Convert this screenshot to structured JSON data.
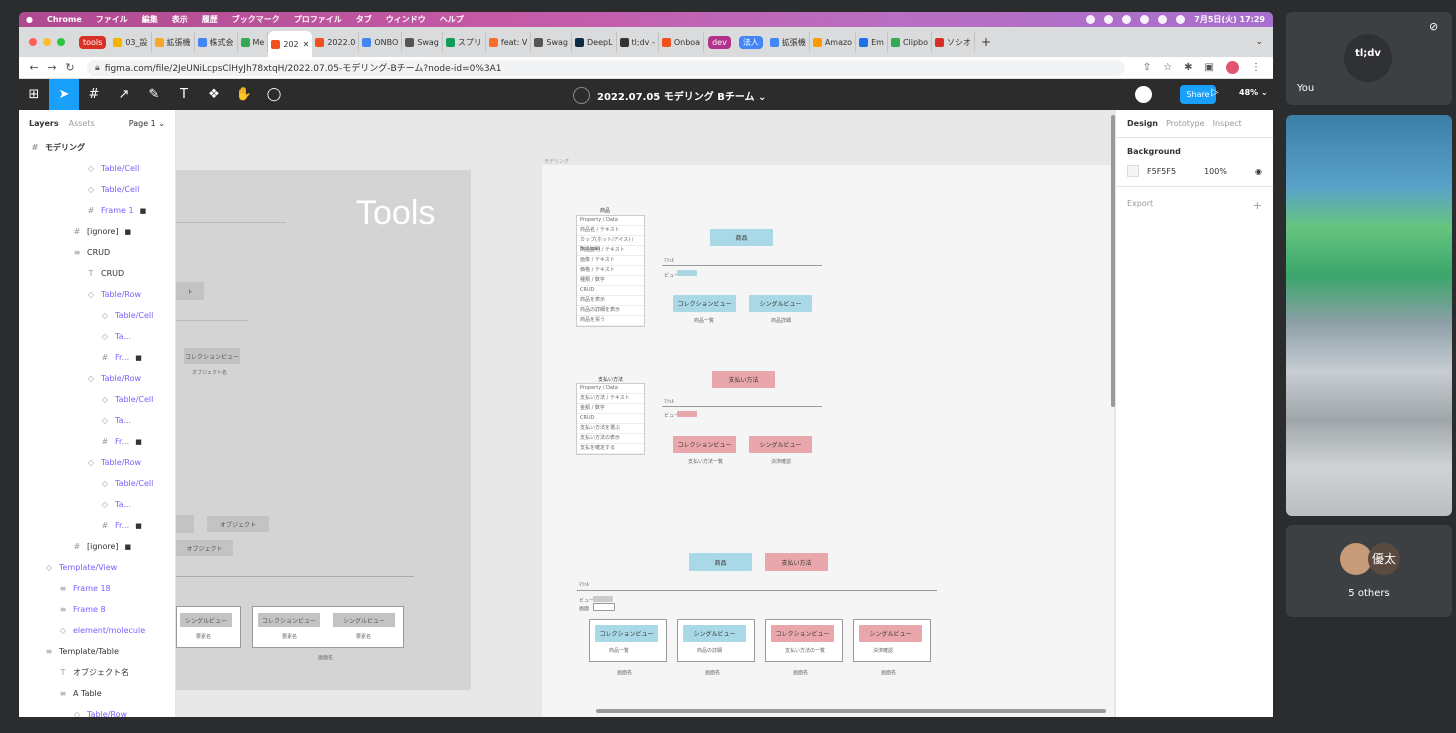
{
  "menubar": {
    "app": "Chrome",
    "items": [
      "ファイル",
      "編集",
      "表示",
      "履歴",
      "ブックマーク",
      "プロファイル",
      "タブ",
      "ウィンドウ",
      "ヘルプ"
    ],
    "datetime": "7月5日(火) 17:29"
  },
  "tabs": [
    {
      "label": "tools",
      "kind": "pill",
      "color": "#d93025"
    },
    {
      "label": "03_設",
      "color": "#f4b400"
    },
    {
      "label": "拡張機",
      "color": "#f9a825"
    },
    {
      "label": "株式会",
      "color": "#4285f4"
    },
    {
      "label": "Me",
      "color": "#34a853"
    },
    {
      "label": "202",
      "color": "#f24e1e",
      "active": true
    },
    {
      "label": "2022.0",
      "color": "#f24e1e"
    },
    {
      "label": "ONBO",
      "color": "#4285f4"
    },
    {
      "label": "Swag",
      "color": "#555555"
    },
    {
      "label": "スプリ",
      "color": "#0f9d58"
    },
    {
      "label": "feat: V",
      "color": "#fc6d26"
    },
    {
      "label": "Swag",
      "color": "#555555"
    },
    {
      "label": "DeepL",
      "color": "#0f2b46"
    },
    {
      "label": "tl;dv -",
      "color": "#333333"
    },
    {
      "label": "Onboa",
      "color": "#f24e1e"
    },
    {
      "label": "dev",
      "kind": "pill",
      "color": "#b0328a"
    },
    {
      "label": "法人",
      "kind": "pill",
      "color": "#4285f4"
    },
    {
      "label": "拡張機",
      "color": "#4285f4"
    },
    {
      "label": "Amazo",
      "color": "#ff9900"
    },
    {
      "label": "Em",
      "color": "#1a73e8"
    },
    {
      "label": "Clipbo",
      "color": "#34a853"
    },
    {
      "label": "ソシオ",
      "color": "#d93025"
    }
  ],
  "address": {
    "url": "figma.com/file/2JeUNiLcpsClHyJh78xtqH/2022.07.05-モデリング-Bチーム?node-id=0%3A1"
  },
  "figma": {
    "title": "2022.07.05 モデリング Bチーム",
    "share": "Share",
    "zoom": "48%"
  },
  "layers": {
    "tabs": [
      "Layers",
      "Assets"
    ],
    "page": "Page 1",
    "root": "モデリング",
    "rows": [
      {
        "label": "Table/Cell",
        "indent": 4,
        "icon": "◇",
        "purple": true
      },
      {
        "label": "Table/Cell",
        "indent": 4,
        "icon": "◇",
        "purple": true
      },
      {
        "label": "Frame 1",
        "indent": 4,
        "icon": "#",
        "purple": true,
        "lock": true
      },
      {
        "label": "[ignore]",
        "indent": 3,
        "icon": "#",
        "lock": true
      },
      {
        "label": "CRUD",
        "indent": 3,
        "icon": "≡"
      },
      {
        "label": "CRUD",
        "indent": 4,
        "icon": "T"
      },
      {
        "label": "Table/Row",
        "indent": 4,
        "icon": "◇",
        "purple": true
      },
      {
        "label": "Table/Cell",
        "indent": 5,
        "icon": "◇",
        "purple": true
      },
      {
        "label": "Ta...",
        "indent": 5,
        "icon": "◇",
        "purple": true
      },
      {
        "label": "Fr...",
        "indent": 5,
        "icon": "#",
        "purple": true,
        "lock": true
      },
      {
        "label": "Table/Row",
        "indent": 4,
        "icon": "◇",
        "purple": true
      },
      {
        "label": "Table/Cell",
        "indent": 5,
        "icon": "◇",
        "purple": true
      },
      {
        "label": "Ta...",
        "indent": 5,
        "icon": "◇",
        "purple": true
      },
      {
        "label": "Fr...",
        "indent": 5,
        "icon": "#",
        "purple": true,
        "lock": true
      },
      {
        "label": "Table/Row",
        "indent": 4,
        "icon": "◇",
        "purple": true
      },
      {
        "label": "Table/Cell",
        "indent": 5,
        "icon": "◇",
        "purple": true
      },
      {
        "label": "Ta...",
        "indent": 5,
        "icon": "◇",
        "purple": true
      },
      {
        "label": "Fr...",
        "indent": 5,
        "icon": "#",
        "purple": true,
        "lock": true
      },
      {
        "label": "[ignore]",
        "indent": 3,
        "icon": "#",
        "lock": true
      },
      {
        "label": "Template/View",
        "indent": 1,
        "icon": "◇",
        "purple": true
      },
      {
        "label": "Frame 18",
        "indent": 2,
        "icon": "≡",
        "purple": true
      },
      {
        "label": "Frame 8",
        "indent": 2,
        "icon": "≡",
        "purple": true
      },
      {
        "label": "element/molecule",
        "indent": 2,
        "icon": "◇",
        "purple": true
      },
      {
        "label": "Template/Table",
        "indent": 1,
        "icon": "≡"
      },
      {
        "label": "オブジェクト名",
        "indent": 2,
        "icon": "T"
      },
      {
        "label": "A Table",
        "indent": 2,
        "icon": "≡"
      },
      {
        "label": "Table/Row",
        "indent": 3,
        "icon": "◇",
        "purple": true
      }
    ]
  },
  "canvas": {
    "tools_title": "Tools",
    "frame_label": "モデリング",
    "tools_boxes": [
      "コレクションビュー",
      "オブジェクト名",
      "オブジェクト",
      "オブジェクト",
      "シングルビュー",
      "コレクションビュー",
      "シングルビュー",
      "要素名",
      "要素名",
      "要素名",
      "画面名"
    ],
    "product_table": {
      "title": "商品",
      "rows": [
        "Property / Data",
        "商品名 / テキスト",
        "カップ(ホット/アイス) / Boolean",
        "商品説明 / テキスト",
        "画像 / テキスト",
        "価格 / テキスト",
        "種類 / 数字",
        "CRUD",
        "商品を表示",
        "商品の詳細を表示",
        "商品を買う"
      ]
    },
    "order_table": {
      "title": "支払い方法",
      "rows": [
        "Property / Data",
        "支払い方法 / テキスト",
        "金額 / 数字",
        "CRUD",
        "支払い方法を選ぶ",
        "支払い方法の表示",
        "支払を確定する"
      ]
    },
    "product_diagram": {
      "object": "商品",
      "coll": "コレクションビュー",
      "single": "シングルビュー",
      "coll_sub": "商品一覧",
      "single_sub": "商品詳細"
    },
    "payment_diagram": {
      "object": "支払い方法",
      "coll": "コレクションビュー",
      "single": "シングルビュー",
      "coll_sub": "支払い方法一覧",
      "single_sub": "決済確認"
    },
    "flow": {
      "obj1": "商品",
      "obj2": "支払い方法",
      "screens": [
        {
          "box": "コレクションビュー",
          "sub": "商品一覧",
          "name": "画面名",
          "color": "blue"
        },
        {
          "box": "シングルビュー",
          "sub": "商品の詳細",
          "name": "画面名",
          "color": "blue"
        },
        {
          "box": "コレクションビュー",
          "sub": "支払い方法の一覧",
          "name": "画面名",
          "color": "pink"
        },
        {
          "box": "シングルビュー",
          "sub": "決済確認",
          "name": "画面名",
          "color": "pink"
        }
      ]
    }
  },
  "design": {
    "tabs": [
      "Design",
      "Prototype",
      "Inspect"
    ],
    "background_label": "Background",
    "bg_hex": "F5F5F5",
    "bg_opacity": "100%",
    "export_label": "Export"
  },
  "meet": {
    "you": "You",
    "tldv_logo": "tl;dv",
    "others_name": "優太",
    "others_count": "5 others"
  }
}
